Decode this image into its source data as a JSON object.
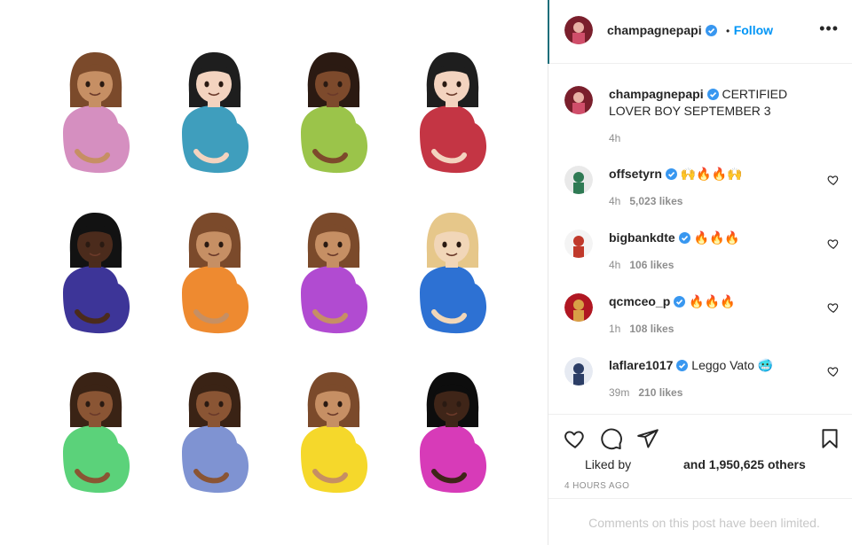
{
  "post": {
    "author": "champagnepapi",
    "follow_sep": "•",
    "follow_label": "Follow",
    "more_label": "•••",
    "caption": "CERTIFIED LOVER BOY SEPTEMBER 3",
    "caption_age": "4h",
    "emoji_grid": [
      {
        "skin": "#c68f64",
        "hair": "#7b4a2b",
        "shirt": "#d58fc0"
      },
      {
        "skin": "#f3d3bf",
        "hair": "#1e1e1e",
        "shirt": "#3f9ebd"
      },
      {
        "skin": "#7d4a2c",
        "hair": "#2b1a12",
        "shirt": "#9bc44a"
      },
      {
        "skin": "#f3d3bf",
        "hair": "#1e1e1e",
        "shirt": "#c43544"
      },
      {
        "skin": "#4b2b1c",
        "hair": "#121212",
        "shirt": "#3d3598"
      },
      {
        "skin": "#c68f64",
        "hair": "#7b4a2b",
        "shirt": "#ee8a30"
      },
      {
        "skin": "#c68f64",
        "hair": "#7b4a2b",
        "shirt": "#b14bd1"
      },
      {
        "skin": "#f1d6b8",
        "hair": "#e6c78a",
        "shirt": "#2d71d3"
      },
      {
        "skin": "#8a5534",
        "hair": "#3a2315",
        "shirt": "#5bd27a"
      },
      {
        "skin": "#8a5534",
        "hair": "#3a2315",
        "shirt": "#7f93d2"
      },
      {
        "skin": "#c68f64",
        "hair": "#7b4a2b",
        "shirt": "#f5d82b"
      },
      {
        "skin": "#3f2518",
        "hair": "#0d0d0d",
        "shirt": "#d73bb8"
      }
    ]
  },
  "comments": [
    {
      "user": "offsetyrn",
      "text": "🙌🔥🔥🙌",
      "age": "4h",
      "likes": "5,023 likes"
    },
    {
      "user": "bigbankdte",
      "text": "🔥🔥🔥",
      "age": "4h",
      "likes": "106 likes"
    },
    {
      "user": "qcmceo_p",
      "text": "🔥🔥🔥",
      "age": "1h",
      "likes": "108 likes"
    },
    {
      "user": "laflare1017",
      "text": "Leggo Vato 🥶",
      "age": "39m",
      "likes": "210 likes"
    }
  ],
  "footer": {
    "liked_by": "Liked by",
    "others": "and 1,950,625 others",
    "timestamp": "4 HOURS AGO",
    "limited": "Comments on this post have been limited."
  },
  "colors": {
    "accent": "#0095f6",
    "verified": "#3897f0"
  }
}
